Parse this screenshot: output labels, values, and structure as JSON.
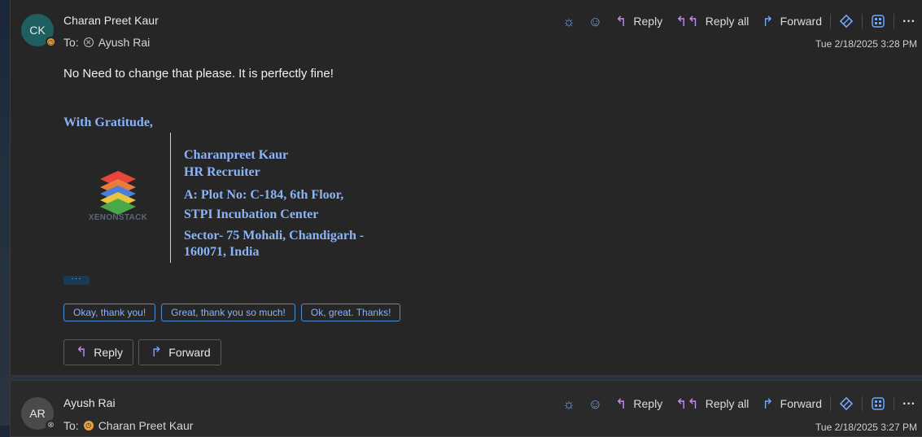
{
  "message1": {
    "avatar_initials": "CK",
    "sender": "Charan Preet Kaur",
    "to_label": "To:",
    "to_name": "Ayush Rai",
    "timestamp": "Tue 2/18/2025 3:28 PM",
    "toolbar": {
      "reply": "Reply",
      "reply_all": "Reply all",
      "forward": "Forward"
    },
    "body": "No Need to change that please. It is perfectly fine!",
    "greeting": "With Gratitude,",
    "signature": {
      "logo_text": "XENONSTACK",
      "name": "Charanpreet Kaur",
      "title": "HR Recruiter",
      "address1": "A: Plot No: C-184, 6th Floor,",
      "address2": "STPI Incubation Center",
      "address3": "Sector- 75 Mohali, Chandigarh -",
      "address4": "160071, India"
    },
    "more_indicator": "···",
    "suggested_replies": [
      "Okay, thank you!",
      "Great, thank you so much!",
      "Ok, great. Thanks!"
    ],
    "actions": {
      "reply": "Reply",
      "forward": "Forward"
    }
  },
  "message2": {
    "avatar_initials": "AR",
    "sender": "Ayush Rai",
    "to_label": "To:",
    "to_name": "Charan Preet Kaur",
    "timestamp": "Tue 2/18/2025 3:27 PM",
    "toolbar": {
      "reply": "Reply",
      "reply_all": "Reply all",
      "forward": "Forward"
    }
  },
  "icons": {
    "sun": "☼",
    "smile": "☺",
    "reply": "↰",
    "forward": "↱",
    "more": "···"
  },
  "colors": {
    "accent_blue": "#8ab4f8",
    "presence_away": "#e8a33c",
    "reply_icon": "#c28be8",
    "forward_icon": "#6ea8ff"
  }
}
